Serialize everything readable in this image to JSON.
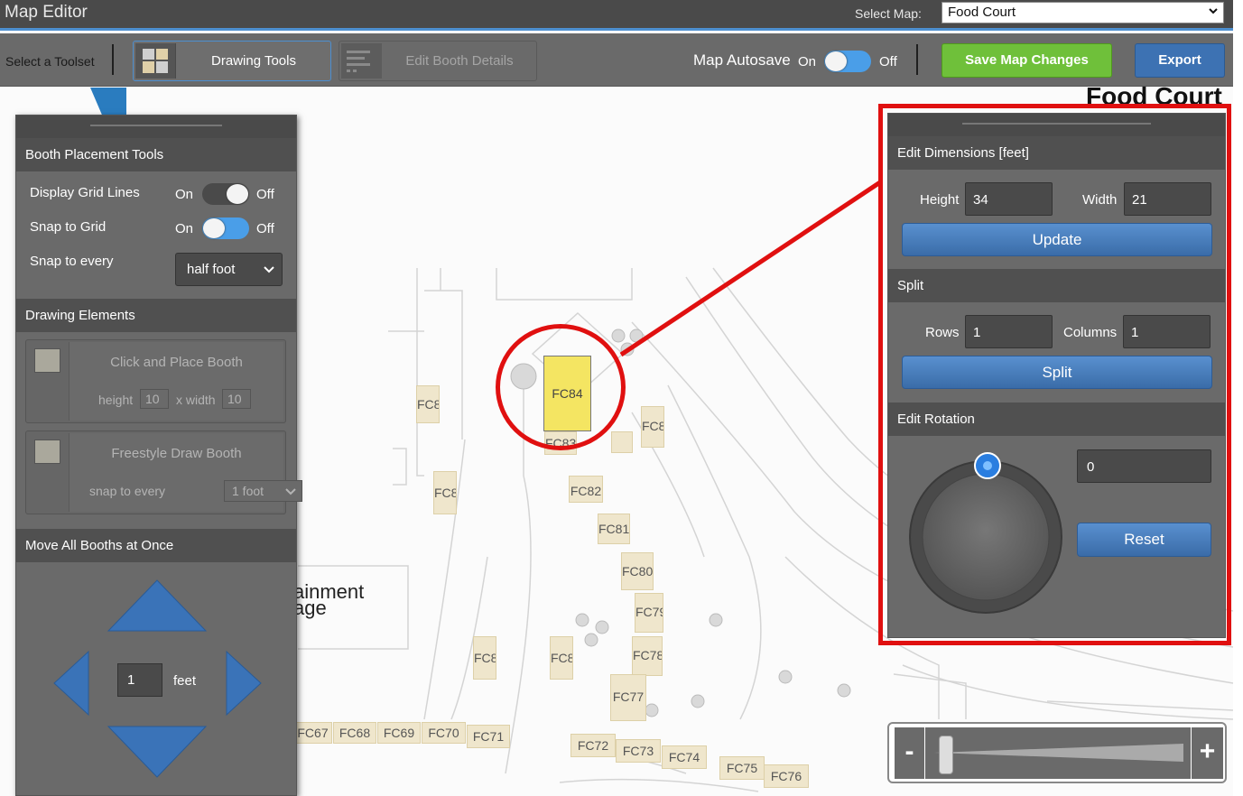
{
  "titlebar": {
    "app_title": "Map Editor",
    "select_map_label": "Select Map:",
    "selected_map": "Food Court"
  },
  "toolbar": {
    "toolset_label": "Select a Toolset",
    "drawing_tools_label": "Drawing Tools",
    "edit_booth_details_label": "Edit Booth Details",
    "autosave_label": "Map Autosave",
    "autosave_on": "On",
    "autosave_off": "Off",
    "autosave_state": "on",
    "save_label": "Save Map Changes",
    "export_label": "Export",
    "colors": {
      "save": "#6fc03a",
      "export": "#3d72b3",
      "accent": "#4d8fd0"
    }
  },
  "map": {
    "title": "Food Court",
    "stage_label_line1": "ainment",
    "stage_label_line2": "age",
    "selected_booth": "FC84",
    "booths": [
      "FC8",
      "FC8",
      "FC8",
      "FC83",
      "FC82",
      "FC81",
      "FC80",
      "FC79",
      "FC78",
      "FC77",
      "FC8",
      "FC8",
      "FC67",
      "FC68",
      "FC69",
      "FC70",
      "FC71",
      "FC72",
      "FC73",
      "FC74",
      "FC75",
      "FC76"
    ]
  },
  "left_panel": {
    "booth_placement_title": "Booth Placement Tools",
    "grid_lines_label": "Display Grid Lines",
    "grid_lines_state": "off",
    "snap_grid_label": "Snap to Grid",
    "snap_grid_state": "on",
    "on": "On",
    "off": "Off",
    "snap_every_label": "Snap to every",
    "snap_every_value": "half foot",
    "drawing_elements_title": "Drawing Elements",
    "click_place_label": "Click and Place Booth",
    "height_label": "height",
    "height_value": "10",
    "width_label": "x width",
    "width_value": "10",
    "freestyle_label": "Freestyle Draw Booth",
    "freestyle_snap_label": "snap to every",
    "freestyle_snap_value": "1 foot",
    "move_title": "Move All Booths at Once",
    "move_value": "1",
    "move_unit": "feet"
  },
  "right_panel": {
    "dimensions_title": "Edit Dimensions [feet]",
    "height_label": "Height",
    "height_value": "34",
    "width_label": "Width",
    "width_value": "21",
    "update_label": "Update",
    "split_title": "Split",
    "rows_label": "Rows",
    "rows_value": "1",
    "columns_label": "Columns",
    "columns_value": "1",
    "split_label": "Split",
    "rotation_title": "Edit Rotation",
    "rotation_value": "0",
    "reset_label": "Reset"
  },
  "zoom": {
    "minus": "-",
    "plus": "+",
    "level": 0.04
  }
}
